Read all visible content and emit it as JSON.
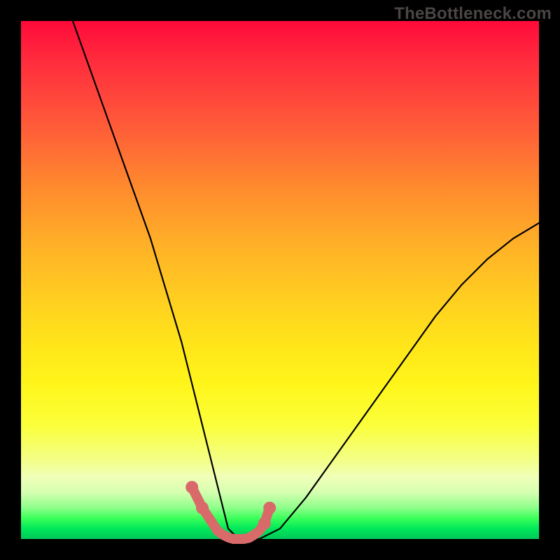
{
  "watermark": "TheBottleneck.com",
  "colors": {
    "frame": "#000000",
    "curve_black": "#000000",
    "curve_pink": "#d96a6a"
  },
  "chart_data": {
    "type": "line",
    "title": "",
    "xlabel": "",
    "ylabel": "",
    "xlim": [
      0,
      100
    ],
    "ylim": [
      0,
      100
    ],
    "series": [
      {
        "name": "bottleneck-curve",
        "x": [
          10,
          15,
          20,
          25,
          28,
          31,
          33,
          35,
          37,
          39,
          40,
          42,
          44,
          46,
          50,
          55,
          60,
          65,
          70,
          75,
          80,
          85,
          90,
          95,
          100
        ],
        "values": [
          100,
          86,
          72,
          58,
          48,
          38,
          30,
          22,
          14,
          6,
          2,
          0,
          0,
          0,
          2,
          8,
          15,
          22,
          29,
          36,
          43,
          49,
          54,
          58,
          61
        ]
      }
    ],
    "highlight_segment": {
      "name": "pink-valley",
      "x": [
        33,
        35,
        37,
        38,
        39,
        40,
        41,
        42,
        43,
        44,
        45,
        46,
        47,
        48
      ],
      "values": [
        10,
        6,
        3,
        1.5,
        0.8,
        0.3,
        0,
        0,
        0,
        0.2,
        0.8,
        1.6,
        3,
        6
      ]
    }
  }
}
